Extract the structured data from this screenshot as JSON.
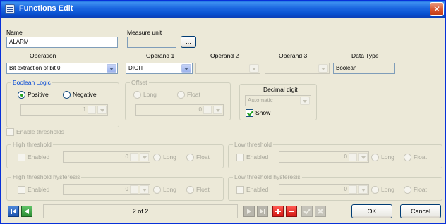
{
  "window": {
    "title": "Functions Edit",
    "close_glyph": "✕"
  },
  "fields": {
    "name_label": "Name",
    "name_value": "ALARM",
    "measure_unit_label": "Measure unit",
    "measure_unit_value": "",
    "browse_label": "..."
  },
  "row": {
    "operation_label": "Operation",
    "operation_value": "Bit extraction of bit 0",
    "operand1_label": "Operand 1",
    "operand1_value": "DIGIT",
    "operand2_label": "Operand 2",
    "operand2_value": "",
    "operand3_label": "Operand 3",
    "operand3_value": "",
    "data_type_label": "Data Type",
    "data_type_value": "Boolean"
  },
  "boolean_logic": {
    "title": "Boolean Logic",
    "positive": "Positive",
    "negative": "Negative",
    "value": "1"
  },
  "offset": {
    "title": "Offset",
    "long": "Long",
    "float": "Float",
    "value": "0"
  },
  "decimal": {
    "title": "Decimal digit",
    "value": "Automatic",
    "show": "Show"
  },
  "thresholds": {
    "enable": "Enable thresholds",
    "high": {
      "title": "High threshold",
      "enabled": "Enabled",
      "value": "0",
      "long": "Long",
      "float": "Float"
    },
    "low": {
      "title": "Low threshold",
      "enabled": "Enabled",
      "value": "0",
      "long": "Long",
      "float": "Float"
    },
    "high_hyst": {
      "title": "High threshold hysteresis",
      "enabled": "Enabled",
      "value": "0",
      "long": "Long",
      "float": "Float"
    },
    "low_hyst": {
      "title": "Low threshold hysteresis",
      "enabled": "Enabled",
      "value": "0",
      "long": "Long",
      "float": "Float"
    }
  },
  "footer": {
    "page": "2 of 2",
    "ok": "OK",
    "cancel": "Cancel"
  },
  "colors": {
    "titlebar": "#0a5fd8",
    "accent_green": "#21a121",
    "add_red": "#e0201c"
  }
}
